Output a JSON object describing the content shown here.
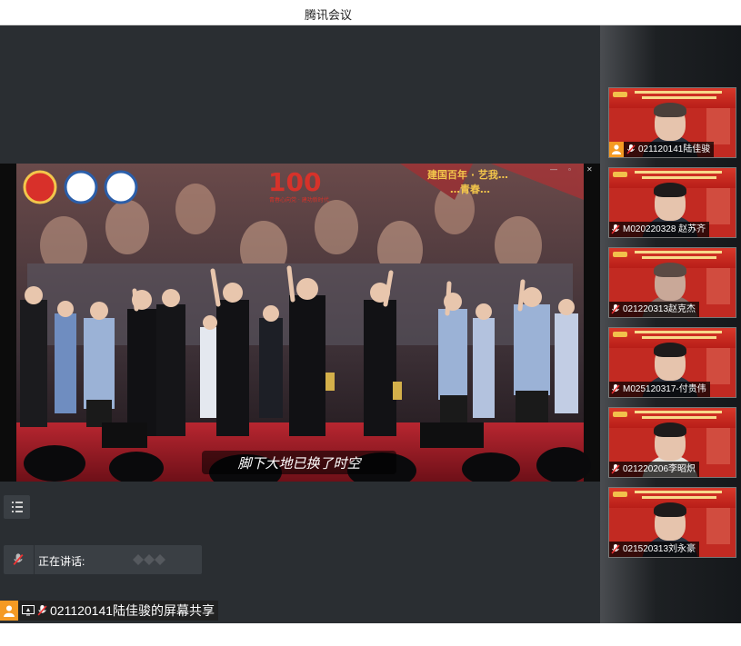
{
  "window": {
    "title": "腾讯会议"
  },
  "share": {
    "subtitle": "脚下大地已换了时空",
    "logo_number": "100",
    "logo_tagline": "青春心向党 · 建功新时代",
    "banner_text_1": "建国百年 · 艺我…",
    "banner_text_2": "…青春…"
  },
  "participants": [
    {
      "name": "021120141陆佳骏",
      "host": true
    },
    {
      "name": "M020220328 赵苏齐",
      "host": false
    },
    {
      "name": "021220313赵克杰",
      "host": false
    },
    {
      "name": "M025120317-付贵伟",
      "host": false
    },
    {
      "name": "021220206李昭炽",
      "host": false
    },
    {
      "name": "021520313刘永豪",
      "host": false
    }
  ],
  "speaking": {
    "label": "正在讲话:"
  },
  "bottom": {
    "share_label": "021120141陆佳骏的屏幕共享"
  },
  "colors": {
    "accent_orange": "#f59a23",
    "tile_red": "#c22a22",
    "bg": "#2a2e32"
  }
}
